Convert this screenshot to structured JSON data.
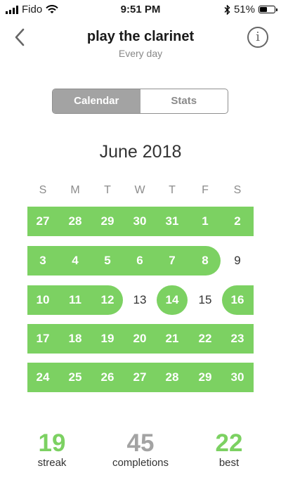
{
  "status_bar": {
    "carrier": "Fido",
    "time": "9:51 PM",
    "battery": "51%",
    "battery_level": 0.51
  },
  "header": {
    "title": "play the clarinet",
    "subtitle": "Every day"
  },
  "segments": [
    {
      "label": "Calendar",
      "active": true
    },
    {
      "label": "Stats",
      "active": false
    }
  ],
  "calendar": {
    "month_label": "June 2018",
    "weekdays": [
      "S",
      "M",
      "T",
      "W",
      "T",
      "F",
      "S"
    ],
    "weeks": [
      [
        {
          "d": "27",
          "on": true
        },
        {
          "d": "28",
          "on": true
        },
        {
          "d": "29",
          "on": true
        },
        {
          "d": "30",
          "on": true
        },
        {
          "d": "31",
          "on": true
        },
        {
          "d": "1",
          "on": true
        },
        {
          "d": "2",
          "on": true
        }
      ],
      [
        {
          "d": "3",
          "on": true
        },
        {
          "d": "4",
          "on": true
        },
        {
          "d": "5",
          "on": true
        },
        {
          "d": "6",
          "on": true
        },
        {
          "d": "7",
          "on": true
        },
        {
          "d": "8",
          "on": true
        },
        {
          "d": "9",
          "on": false
        }
      ],
      [
        {
          "d": "10",
          "on": true
        },
        {
          "d": "11",
          "on": true
        },
        {
          "d": "12",
          "on": true
        },
        {
          "d": "13",
          "on": false
        },
        {
          "d": "14",
          "on": true
        },
        {
          "d": "15",
          "on": false
        },
        {
          "d": "16",
          "on": true
        }
      ],
      [
        {
          "d": "17",
          "on": true
        },
        {
          "d": "18",
          "on": true
        },
        {
          "d": "19",
          "on": true
        },
        {
          "d": "20",
          "on": true
        },
        {
          "d": "21",
          "on": true
        },
        {
          "d": "22",
          "on": true
        },
        {
          "d": "23",
          "on": true
        }
      ],
      [
        {
          "d": "24",
          "on": true
        },
        {
          "d": "25",
          "on": true
        },
        {
          "d": "26",
          "on": true
        },
        {
          "d": "27",
          "on": true
        },
        {
          "d": "28",
          "on": true
        },
        {
          "d": "29",
          "on": true
        },
        {
          "d": "30",
          "on": true
        }
      ]
    ]
  },
  "stats": [
    {
      "value": "19",
      "label": "streak",
      "color": "#7cd162"
    },
    {
      "value": "45",
      "label": "completions",
      "color": "#a3a3a3"
    },
    {
      "value": "22",
      "label": "best",
      "color": "#7cd162"
    }
  ],
  "colors": {
    "accent": "#7cd162",
    "segment_active": "#a3a3a3"
  }
}
